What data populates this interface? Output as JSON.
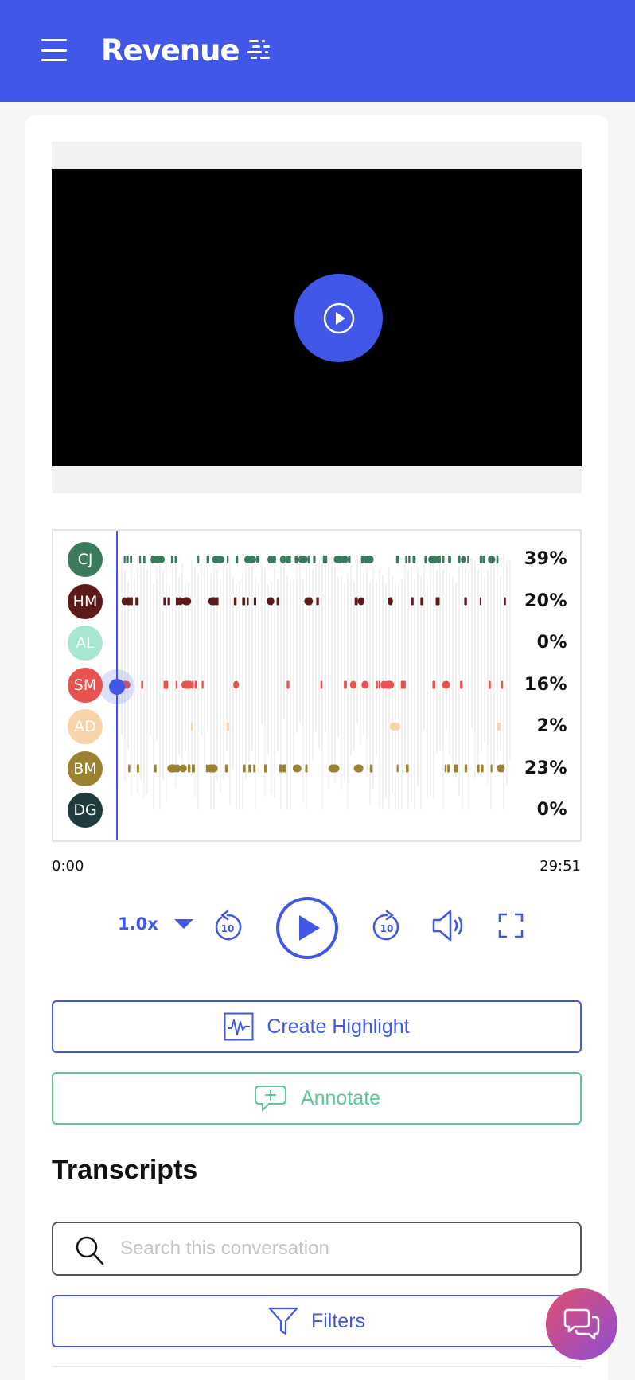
{
  "header": {
    "brand": "Revenue",
    "bg_color": "#4157e8"
  },
  "player": {
    "speakers": [
      {
        "initials": "CJ",
        "percent": "39%",
        "color": "#3b7a5c"
      },
      {
        "initials": "HM",
        "percent": "20%",
        "color": "#5c1a1a"
      },
      {
        "initials": "AL",
        "percent": "0%",
        "color": "#a8e6d4"
      },
      {
        "initials": "SM",
        "percent": "16%",
        "color": "#e8524f"
      },
      {
        "initials": "AD",
        "percent": "2%",
        "color": "#f8d4aa"
      },
      {
        "initials": "BM",
        "percent": "23%",
        "color": "#9a8230"
      },
      {
        "initials": "DG",
        "percent": "0%",
        "color": "#1f3b3e"
      }
    ],
    "time_start": "0:00",
    "time_end": "29:51",
    "speed": "1.0x",
    "skip_back_seconds": "10",
    "skip_forward_seconds": "10",
    "progress": 0
  },
  "actions": {
    "create_highlight": "Create Highlight",
    "annotate": "Annotate"
  },
  "transcripts": {
    "title": "Transcripts",
    "search_placeholder": "Search this conversation",
    "filters": "Filters"
  },
  "icons": {
    "menu": "hamburger-icon",
    "play": "play-icon",
    "rewind": "rewind-10-icon",
    "forward": "forward-10-icon",
    "volume": "volume-icon",
    "fullscreen": "fullscreen-icon",
    "highlight": "waveform-icon",
    "annotate": "comment-plus-icon",
    "search": "search-icon",
    "filter": "filter-icon",
    "chat": "chat-icon"
  }
}
